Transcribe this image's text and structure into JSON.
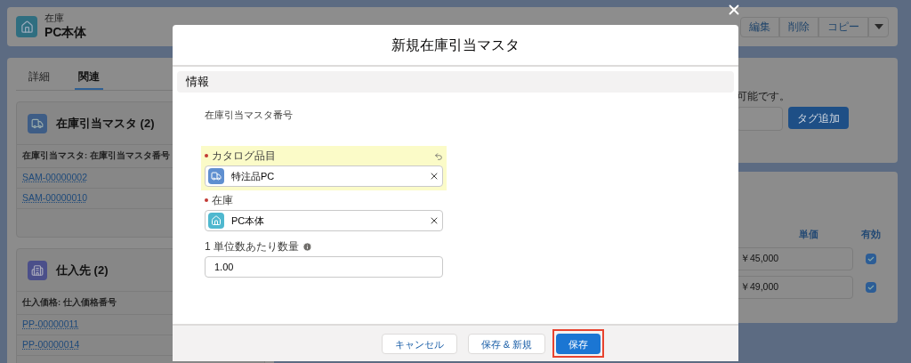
{
  "record": {
    "object": "在庫",
    "name": "PC本体",
    "actions": [
      "編集",
      "削除",
      "コピー"
    ]
  },
  "tabs": [
    {
      "label": "詳細",
      "selected": false
    },
    {
      "label": "関連",
      "selected": true
    }
  ],
  "related_lists": [
    {
      "kind": "allocation",
      "title": "在庫引当マスタ (2)",
      "column": "在庫引当マスタ: 在庫引当マスタ番号",
      "rows": [
        "SAM-00000002",
        "SAM-00000010"
      ]
    },
    {
      "kind": "supplier",
      "title": "仕入先 (2)",
      "column": "仕入価格: 仕入価格番号",
      "rows": [
        "PP-00000011",
        "PP-00000014"
      ]
    }
  ],
  "tags": {
    "hint": "可能です。",
    "button": "タグ追加"
  },
  "price_table": {
    "columns": [
      "単価",
      "有効"
    ],
    "rows": [
      {
        "price": "￥45,000",
        "checked": true
      },
      {
        "price": "￥49,000",
        "checked": true
      }
    ]
  },
  "modal": {
    "title": "新規在庫引当マスタ",
    "section": "情報",
    "fields": [
      {
        "kind": "readonly",
        "label": "在庫引当マスタ番号"
      },
      {
        "kind": "lookup",
        "label": "カタログ品目",
        "required": true,
        "changed": true,
        "value": "特注品PC"
      },
      {
        "kind": "lookup",
        "label": "在庫",
        "required": true,
        "changed": false,
        "value": "PC本体"
      },
      {
        "kind": "number",
        "label": "1 単位数あたり数量",
        "info": true,
        "value": "1.00"
      }
    ],
    "buttons": [
      {
        "label": "キャンセル",
        "kind": "neutral",
        "highlighted": false
      },
      {
        "label": "保存 & 新規",
        "kind": "neutral",
        "highlighted": false
      },
      {
        "label": "保存",
        "kind": "brand",
        "highlighted": true
      }
    ]
  }
}
